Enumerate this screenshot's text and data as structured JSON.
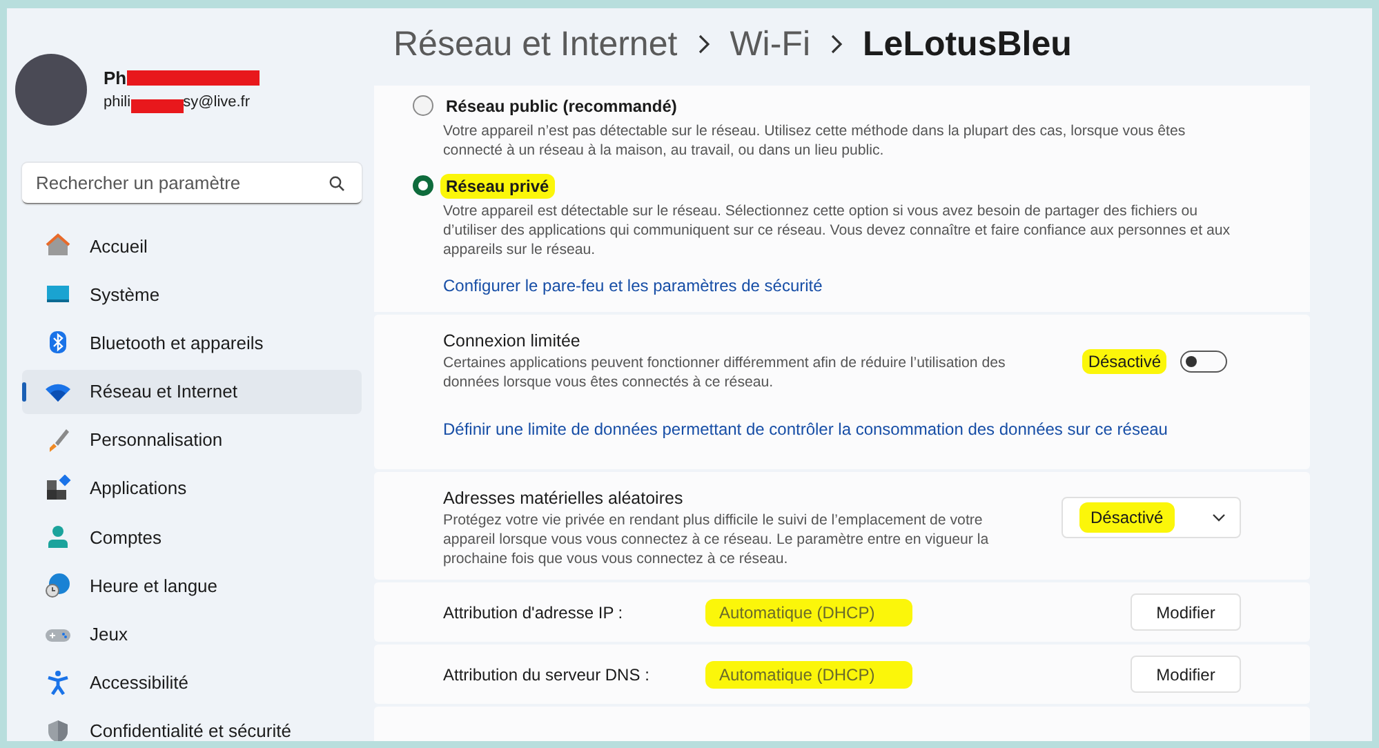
{
  "user": {
    "name": "Ph",
    "email_start": "phili",
    "email_end": "sy@live.fr",
    "redacted": true
  },
  "search": {
    "placeholder": "Rechercher un paramètre"
  },
  "sidebar": {
    "items": [
      {
        "label": "Accueil",
        "selected": false
      },
      {
        "label": "Système",
        "selected": false
      },
      {
        "label": "Bluetooth et appareils",
        "selected": false
      },
      {
        "label": "Réseau et Internet",
        "selected": true
      },
      {
        "label": "Personnalisation",
        "selected": false
      },
      {
        "label": "Applications",
        "selected": false
      },
      {
        "label": "Comptes",
        "selected": false
      },
      {
        "label": "Heure et langue",
        "selected": false
      },
      {
        "label": "Jeux",
        "selected": false
      },
      {
        "label": "Accessibilité",
        "selected": false
      },
      {
        "label": "Confidentialité et sécurité",
        "selected": false
      }
    ]
  },
  "breadcrumb": [
    "Réseau et Internet",
    "Wi-Fi",
    "LeLotusBleu"
  ],
  "profile_options": [
    {
      "label": "Réseau public (recommandé)",
      "selected": false,
      "highlighted": false,
      "description": "Votre appareil n’est pas détectable sur le réseau. Utilisez cette méthode dans la plupart des cas, lorsque vous êtes connecté à un réseau à la maison, au travail, ou dans un lieu public."
    },
    {
      "label": "Réseau privé",
      "selected": true,
      "highlighted": true,
      "description": "Votre appareil est détectable sur le réseau. Sélectionnez cette option si vous avez besoin de partager des fichiers ou d’utiliser des applications qui communiquent sur ce réseau. Vous devez connaître et faire confiance aux personnes et aux appareils sur le réseau."
    }
  ],
  "firewall_link": "Configurer le pare-feu et les paramètres de sécurité",
  "metered": {
    "title": "Connexion limitée",
    "description": "Certaines applications peuvent fonctionner différemment afin de réduire l’utilisation des données lorsque vous êtes connectés à ce réseau.",
    "state_label": "Désactivé",
    "on": false,
    "highlighted": true,
    "link": "Définir une limite de données permettant de contrôler la consommation des données sur ce réseau"
  },
  "random_mac": {
    "title": "Adresses matérielles aléatoires",
    "description": "Protégez votre vie privée en rendant plus difficile le suivi de l’emplacement de votre appareil lorsque vous vous connectez à ce réseau. Le paramètre entre en vigueur la prochaine fois que vous vous connectez à ce réseau.",
    "value": "Désactivé",
    "highlighted": true
  },
  "assignments": [
    {
      "label": "Attribution d'adresse IP :",
      "value": "Automatique (DHCP)",
      "button": "Modifier",
      "highlighted": true
    },
    {
      "label": "Attribution du serveur DNS :",
      "value": "Automatique (DHCP)",
      "button": "Modifier",
      "highlighted": true
    }
  ]
}
